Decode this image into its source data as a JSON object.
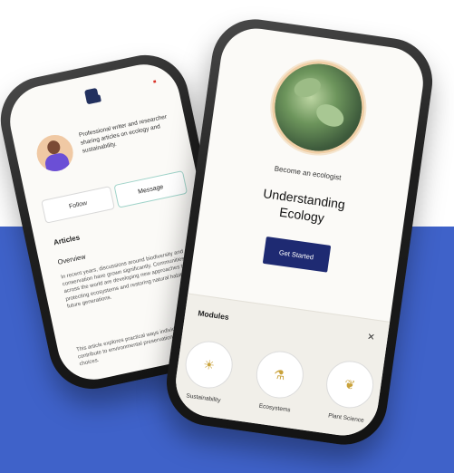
{
  "left_phone": {
    "cart_icon": "cart-icon",
    "profile_bio": "Professional writer and researcher sharing articles on ecology and sustainability.",
    "button_left": "Follow",
    "button_right": "Message",
    "section_heading": "Articles",
    "subheading": "Overview",
    "paragraph_1": "In recent years, discussions around biodiversity and conservation have grown significantly. Communities across the world are developing new approaches to protecting ecosystems and restoring natural habitats for future generations.",
    "paragraph_2": "This article explores practical ways individuals can contribute to environmental preservation through daily choices."
  },
  "right_phone": {
    "subtitle": "Become an ecologist",
    "title_line1": "Understanding",
    "title_line2": "Ecology",
    "cta_label": "Get Started",
    "panel_title": "Modules",
    "close_icon": "close-icon",
    "modules": [
      {
        "icon": "sun-icon",
        "label": "Sustainability"
      },
      {
        "icon": "flask-icon",
        "label": "Ecosystems"
      },
      {
        "icon": "leaf-icon",
        "label": "Plant Science"
      }
    ]
  },
  "colors": {
    "accent_blue": "#3f62c9",
    "cta_navy": "#1e2a72",
    "avatar_purple": "#6b4fd6"
  }
}
